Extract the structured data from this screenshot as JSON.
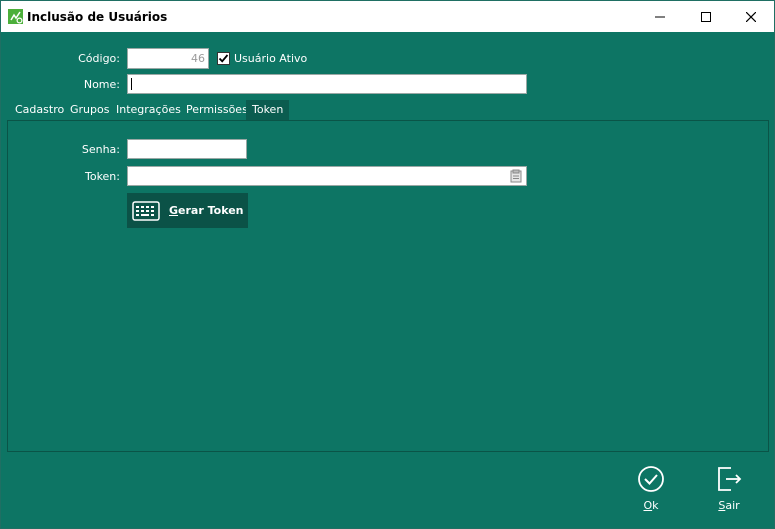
{
  "window": {
    "title": "Inclusão de Usuários",
    "controls": {
      "minimize": "minimize-icon",
      "maximize": "maximize-icon",
      "close": "close-icon"
    }
  },
  "form": {
    "codigo_label": "Código:",
    "codigo_value": "46",
    "ativo_label": "Usuário Ativo",
    "ativo_checked": true,
    "nome_label": "Nome:",
    "nome_value": ""
  },
  "tabs": [
    {
      "label": "Cadastro",
      "active": false
    },
    {
      "label": "Grupos",
      "active": false
    },
    {
      "label": "Integrações",
      "active": false
    },
    {
      "label": "Permissões",
      "active": false
    },
    {
      "label": "Token",
      "active": true
    }
  ],
  "token_tab": {
    "senha_label": "Senha:",
    "senha_value": "",
    "token_label": "Token:",
    "token_value": "",
    "gerar_token_underline": "G",
    "gerar_token_rest": "erar Token"
  },
  "footer": {
    "ok_underline": "O",
    "ok_rest": "k",
    "sair_underline": "S",
    "sair_rest": "air"
  },
  "colors": {
    "background": "#0d7564",
    "button_dark": "#0b5247",
    "active_tab": "#0b5c4f"
  }
}
